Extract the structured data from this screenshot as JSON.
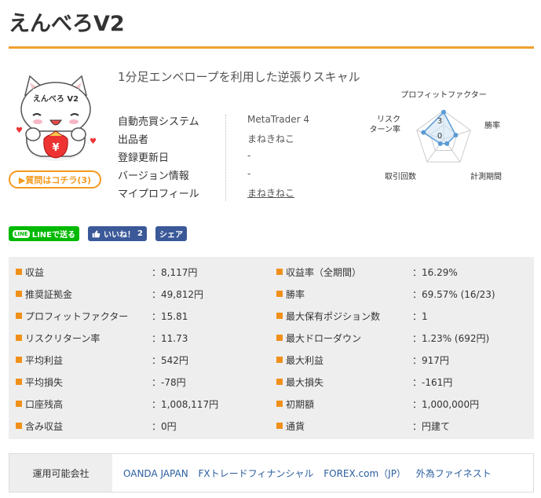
{
  "page": {
    "title": "えんべろV2"
  },
  "mascot": {
    "sign_text": "えんべろ V2",
    "coin_symbol": "¥"
  },
  "ask_button": {
    "label": "▶質問はコチラ(3)"
  },
  "description": "1分足エンベロープを利用した逆張りスキャル",
  "info": [
    {
      "label": "自動売買システム",
      "value": "MetaTrader 4",
      "link": false
    },
    {
      "label": "出品者",
      "value": "まねきねこ",
      "link": false
    },
    {
      "label": "登録更新日",
      "value": "-",
      "link": false
    },
    {
      "label": "バージョン情報",
      "value": "-",
      "link": false
    },
    {
      "label": "マイプロフィール",
      "value": "まねきねこ",
      "link": true
    }
  ],
  "radar": {
    "axes": [
      "プロフィットファクター",
      "勝率",
      "計測期間",
      "取引回数",
      "リスクリターン率"
    ],
    "axis_lines": {
      "risk": [
        "リスク",
        "ターン率"
      ]
    },
    "scale_labels": {
      "max": "3",
      "min": "0"
    },
    "values": [
      0.95,
      0.45,
      0.2,
      0.2,
      0.75
    ],
    "colors": {
      "grid": "#cccccc",
      "series": "#5b9bd5",
      "fill": "#cfe2f3"
    }
  },
  "social": {
    "line_icon": "LINE",
    "line_label": "LINEで送る",
    "like_label": "いいね！",
    "like_count": "2",
    "share_label": "シェア"
  },
  "stats_left": [
    {
      "key": "収益",
      "value": "：8,117円"
    },
    {
      "key": "推奨証拠金",
      "value": "：49,812円"
    },
    {
      "key": "プロフィットファクター",
      "value": "：15.81"
    },
    {
      "key": "リスクリターン率",
      "value": "：11.73"
    },
    {
      "key": "平均利益",
      "value": "：542円"
    },
    {
      "key": "平均損失",
      "value": "：-78円"
    },
    {
      "key": "口座残高",
      "value": "：1,008,117円"
    },
    {
      "key": "含み収益",
      "value": "：0円"
    }
  ],
  "stats_right": [
    {
      "key": "収益率（全期間）",
      "value": "：16.29%"
    },
    {
      "key": "勝率",
      "value": "：69.57% (16/23)"
    },
    {
      "key": "最大保有ポジション数",
      "value": "：1"
    },
    {
      "key": "最大ドローダウン",
      "value": "：1.23% (692円)"
    },
    {
      "key": "最大利益",
      "value": "：917円"
    },
    {
      "key": "最大損失",
      "value": "：-161円"
    },
    {
      "key": "初期額",
      "value": "：1,000,000円"
    },
    {
      "key": "通貨",
      "value": "：円建て"
    }
  ],
  "companies": {
    "header": "運用可能会社",
    "items": [
      "OANDA JAPAN",
      "FXトレードフィナンシャル",
      "FOREX.com（JP）",
      "外為ファイネスト"
    ]
  },
  "colors": {
    "accent": "#f0a030",
    "line_green": "#00b900",
    "fb_blue": "#3b5998",
    "link_blue": "#2a5d9f"
  }
}
